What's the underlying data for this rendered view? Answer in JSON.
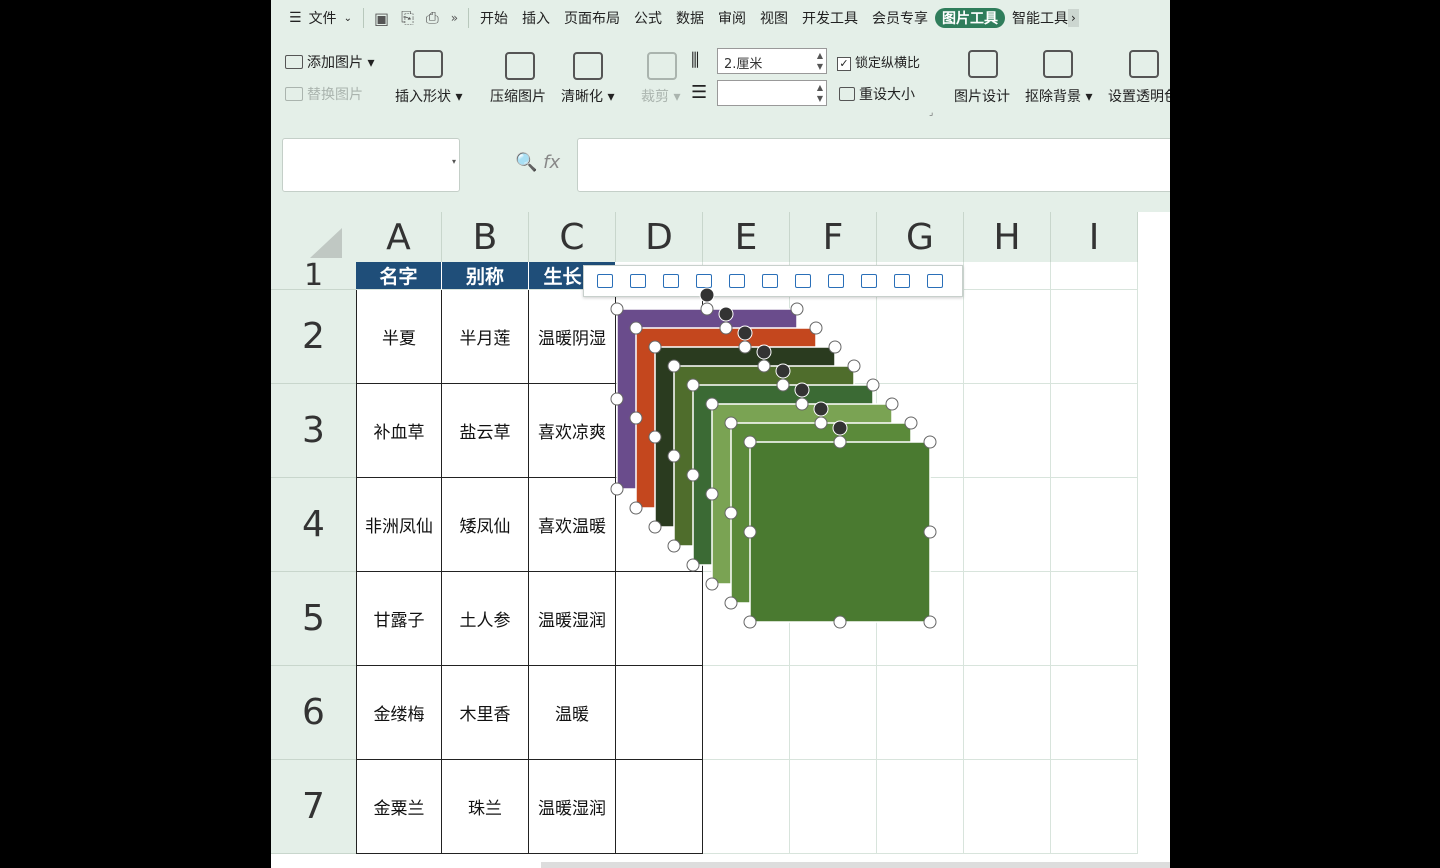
{
  "menu": {
    "file": "文件",
    "tabs": [
      "开始",
      "插入",
      "页面布局",
      "公式",
      "数据",
      "审阅",
      "视图",
      "开发工具",
      "会员专享"
    ],
    "active_tab": "图片工具",
    "next_tab": "智能工具"
  },
  "ribbon": {
    "add_picture": "添加图片",
    "replace_picture": "替换图片",
    "insert_shape": "插入形状",
    "compress": "压缩图片",
    "sharpen": "清晰化",
    "crop": "裁剪",
    "width_value": "2.厘米",
    "height_value": "",
    "lock_ratio": "锁定纵横比",
    "reset_size": "重设大小",
    "picture_design": "图片设计",
    "remove_bg": "抠除背景",
    "set_transparent": "设置透明色"
  },
  "formula": {
    "namebox": "",
    "fx": "fx",
    "content": ""
  },
  "sheet": {
    "columns": [
      "A",
      "B",
      "C",
      "D",
      "E",
      "F",
      "G",
      "H",
      "I"
    ],
    "rows": [
      "1",
      "2",
      "3",
      "4",
      "5",
      "6",
      "7"
    ],
    "header": [
      "名字",
      "别称",
      "生长习"
    ],
    "data": [
      [
        "半夏",
        "半月莲",
        "温暖阴湿"
      ],
      [
        "补血草",
        "盐云草",
        "喜欢凉爽"
      ],
      [
        "非洲凤仙",
        "矮凤仙",
        "喜欢温暖"
      ],
      [
        "甘露子",
        "土人参",
        "温暖湿润"
      ],
      [
        "金缕梅",
        "木里香",
        "温暖"
      ],
      [
        "金粟兰",
        "珠兰",
        "温暖湿润"
      ]
    ]
  },
  "floatbar_icons": [
    "align-left-icon",
    "align-center-icon",
    "align-right-icon",
    "align-top-icon",
    "align-middle-icon",
    "align-bottom-icon",
    "distribute-h-icon",
    "distribute-v-icon",
    "spacing-icon",
    "group-icon",
    "image-options-icon"
  ],
  "colors": {
    "accent": "#2f7d5b",
    "header_fill": "#1f4e79",
    "chrome": "#e4efe8"
  }
}
